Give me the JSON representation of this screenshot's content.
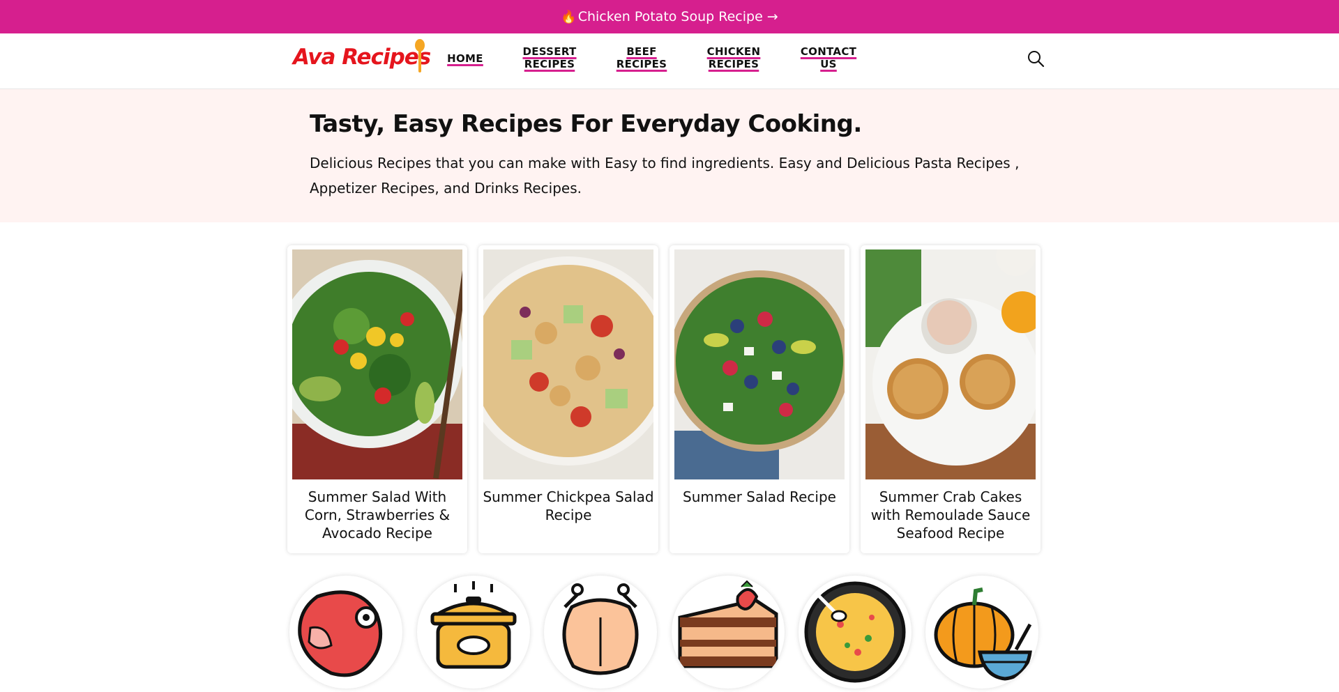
{
  "banner": {
    "icon": "flame-icon",
    "text": "Chicken Potato Soup Recipe →"
  },
  "logo": {
    "text": "Ava Recipes",
    "color": "#e5151d"
  },
  "nav": {
    "home": "HOME",
    "dessert": [
      "DESSERT",
      "RECIPES"
    ],
    "beef": [
      "BEEF",
      "RECIPES"
    ],
    "chicken": [
      "CHICKEN",
      "RECIPES"
    ],
    "contact": [
      "CONTACT",
      "US"
    ]
  },
  "search": {
    "icon": "search-icon"
  },
  "hero": {
    "title": "Tasty, Easy Recipes For Everyday Cooking.",
    "description": "Delicious Recipes that you can make with Easy to find ingredients. Easy and Delicious Pasta Recipes , Appetizer Recipes, and Drinks Recipes."
  },
  "cards": [
    {
      "title": "Summer Salad With Corn, Strawberries & Avocado Recipe"
    },
    {
      "title": "Summer Chickpea Salad Recipe"
    },
    {
      "title": "Summer Salad Recipe"
    },
    {
      "title": "Summer Crab Cakes with Remoulade Sauce Seafood Recipe"
    }
  ],
  "categories": [
    {
      "icon": "steak-icon"
    },
    {
      "icon": "slow-cooker-icon"
    },
    {
      "icon": "roast-chicken-icon"
    },
    {
      "icon": "cake-slice-icon"
    },
    {
      "icon": "soup-bowl-icon"
    },
    {
      "icon": "pumpkin-icon"
    }
  ],
  "colors": {
    "accent": "#d61f8e",
    "hero_bg": "#fff3f2",
    "logo_red": "#e5151d"
  }
}
